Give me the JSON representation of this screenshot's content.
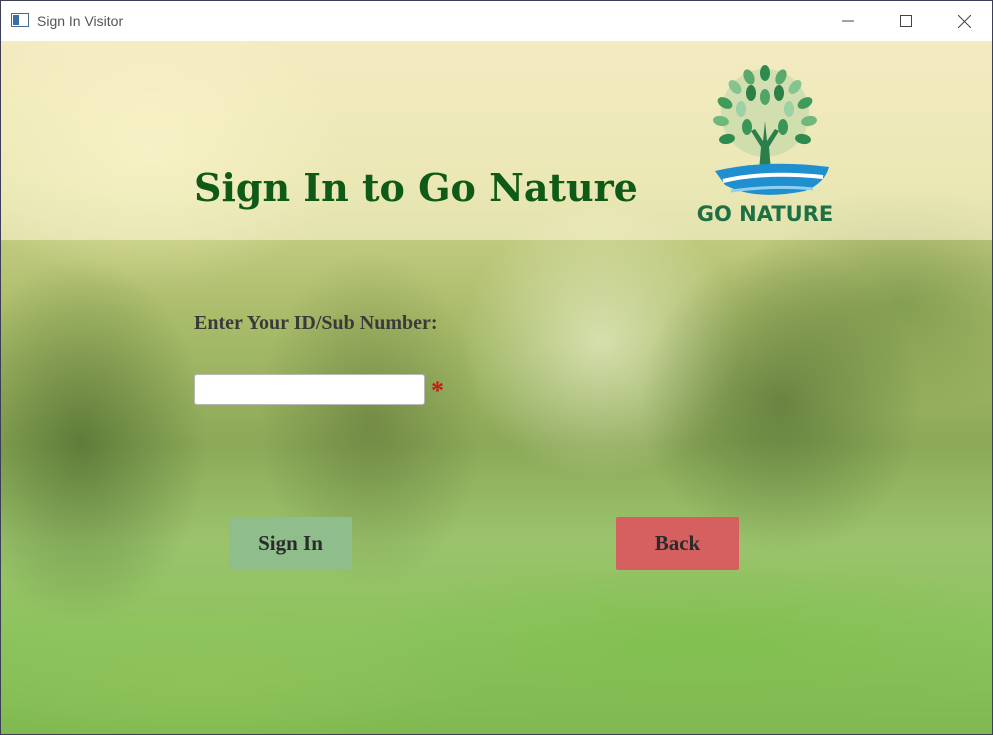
{
  "window": {
    "title": "Sign In Visitor",
    "icon": "app-window-icon",
    "controls": [
      "minimize-icon",
      "maximize-icon",
      "close-icon"
    ]
  },
  "header": {
    "title": "Sign In to Go Nature",
    "title_color": "#0f5a16",
    "logo_text": "GO NATURE"
  },
  "form": {
    "id_label": "Enter Your ID/Sub Number:",
    "id_value": "",
    "id_placeholder": "",
    "required_mark": "*"
  },
  "buttons": {
    "sign_in": "Sign In",
    "back": "Back"
  },
  "colors": {
    "sign_in_bg": "#8fbd8c",
    "back_bg": "#d65f5f",
    "required": "#d01515"
  }
}
